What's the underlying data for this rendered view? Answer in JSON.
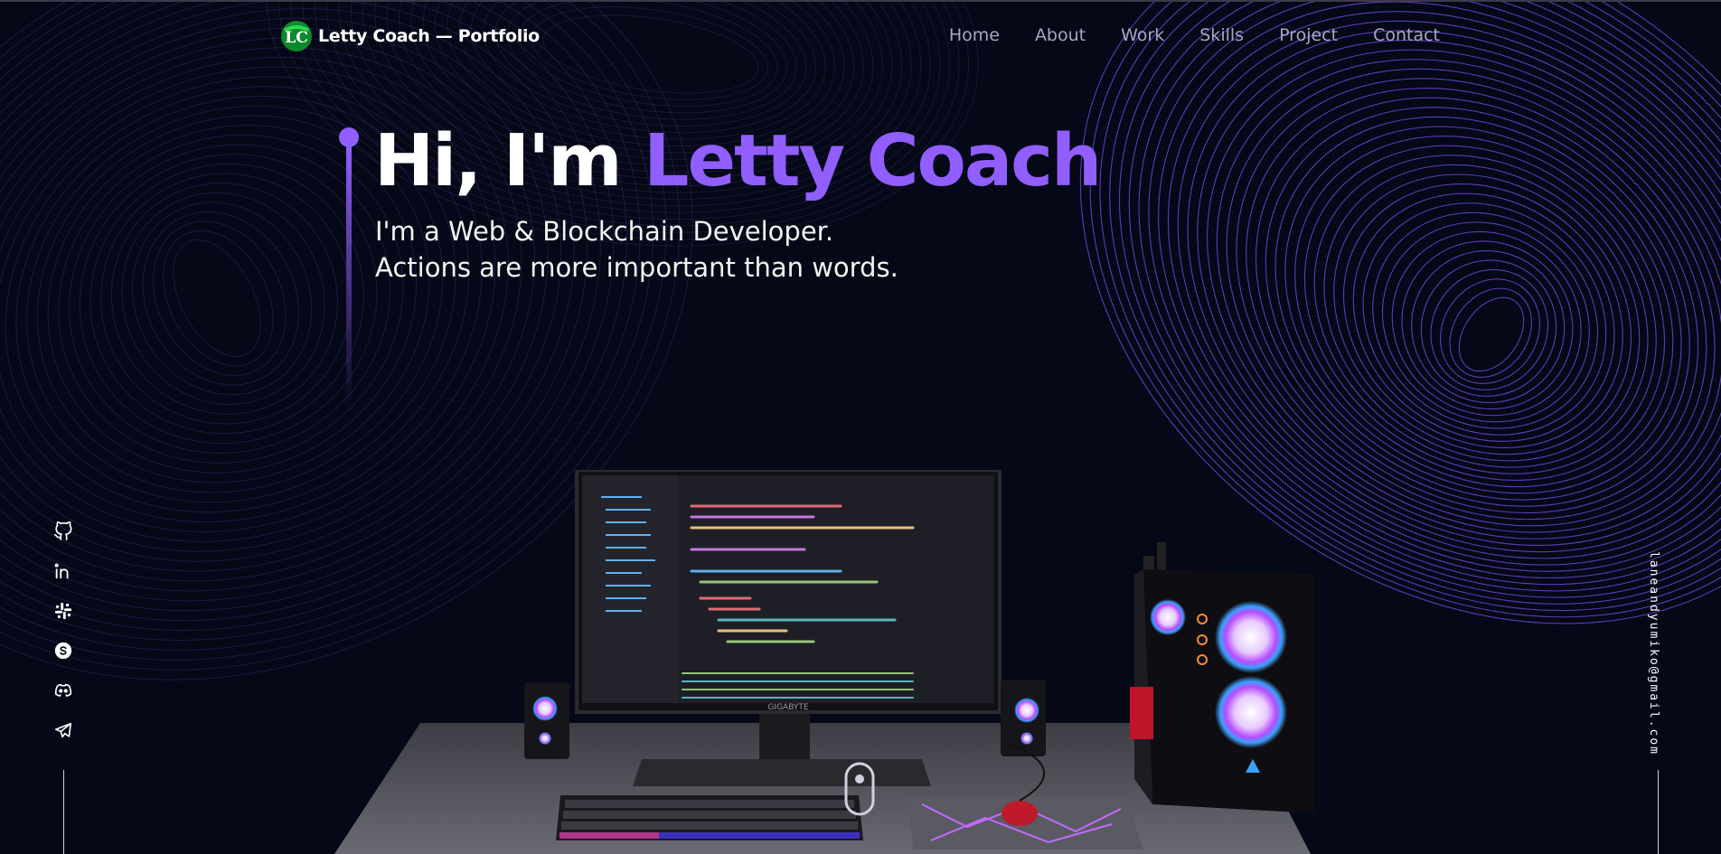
{
  "nav": {
    "logo_initials": "LC",
    "logo_text": "Letty Coach — Portfolio",
    "links": [
      "Home",
      "About",
      "Work",
      "Skills",
      "Project",
      "Contact"
    ]
  },
  "hero": {
    "greeting": "Hi, I'm ",
    "name": "Letty Coach",
    "subtitle_line1": "I'm a Web & Blockchain Developer.",
    "subtitle_line2": "Actions are more important than words."
  },
  "socials": [
    {
      "name": "github-icon"
    },
    {
      "name": "linkedin-icon"
    },
    {
      "name": "slack-icon"
    },
    {
      "name": "skype-icon"
    },
    {
      "name": "discord-icon"
    },
    {
      "name": "telegram-icon"
    }
  ],
  "email": "laneandyumiko@gmail.com",
  "scene": {
    "monitor_brand": "GIGABYTE"
  },
  "colors": {
    "background": "#050816",
    "accent": "#915eff",
    "nav_link": "#aaa6c3"
  }
}
